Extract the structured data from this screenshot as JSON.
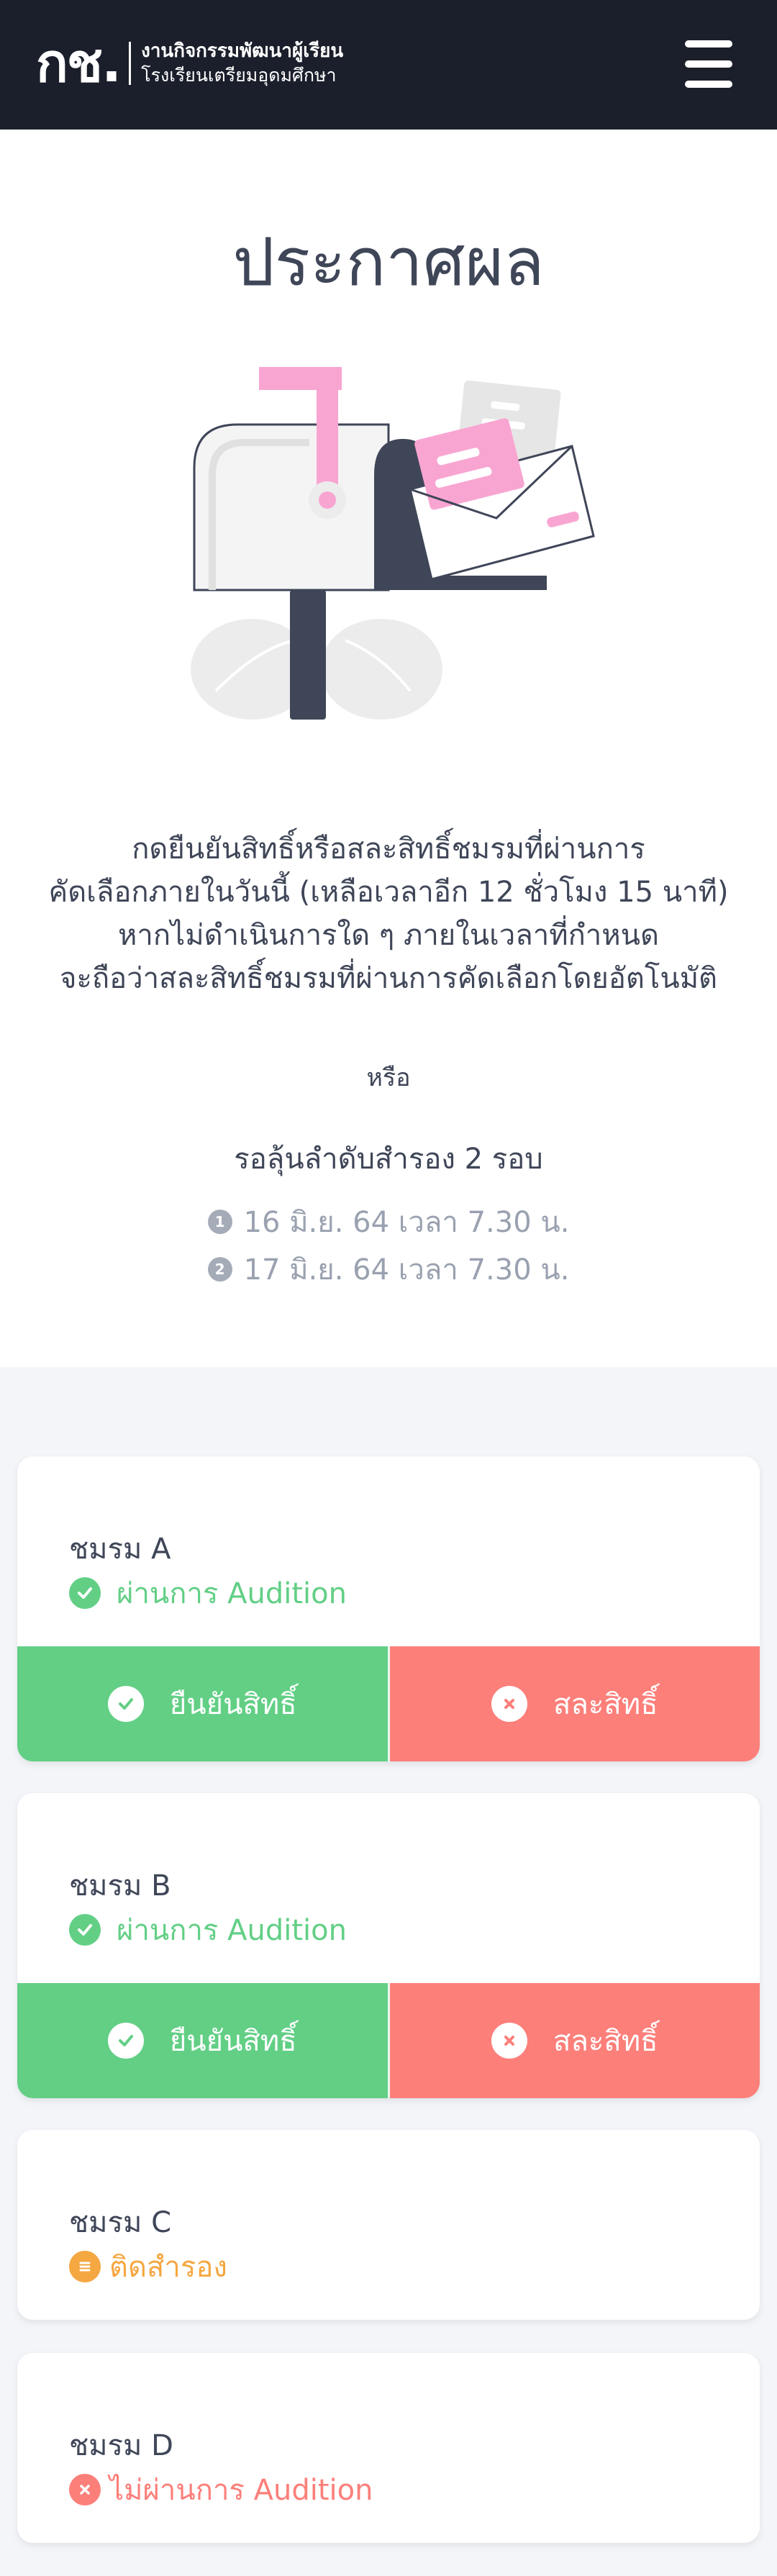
{
  "header": {
    "logo_mark": "กช.",
    "logo_line1": "งานกิจกรรมพัฒนาผู้เรียน",
    "logo_line2": "โรงเรียนเตรียมอุดมศึกษา"
  },
  "page": {
    "title": "ประกาศผล",
    "instructions": [
      "กดยืนยันสิทธิ์หรือสละสิทธิ์ชมรมที่ผ่านการ",
      "คัดเลือกภายในวันนี้ (เหลือเวลาอีก 12 ชั่วโมง 15 นาที)",
      "หากไม่ดำเนินการใด ๆ ภายในเวลาที่กำหนด",
      "จะถือว่าสละสิทธิ์ชมรมที่ผ่านการคัดเลือกโดยอัตโนมัติ"
    ],
    "or": "หรือ",
    "waitlist_heading": "รอลุ้นลำดับสำรอง 2 รอบ",
    "rounds": [
      {
        "num": "1",
        "text": "16 มิ.ย. 64 เวลา 7.30 น."
      },
      {
        "num": "2",
        "text": "17 มิ.ย. 64 เวลา 7.30 น."
      }
    ]
  },
  "cards": [
    {
      "name": "ชมรม A",
      "status": "ผ่านการ Audition",
      "status_type": "passed",
      "confirm": "ยืนยันสิทธิ์",
      "waive": "สละสิทธิ์"
    },
    {
      "name": "ชมรม B",
      "status": "ผ่านการ Audition",
      "status_type": "passed",
      "confirm": "ยืนยันสิทธิ์",
      "waive": "สละสิทธิ์"
    },
    {
      "name": "ชมรม C",
      "status": "ติดสำรอง",
      "status_type": "reserve"
    },
    {
      "name": "ชมรม D",
      "status": "ไม่ผ่านการ Audition",
      "status_type": "failed"
    }
  ],
  "colors": {
    "header_bg": "#1b1f2b",
    "passed": "#62cf85",
    "reserve": "#f5a742",
    "failed": "#fc7f7a",
    "text": "#3f4658",
    "muted": "#9aa1b0",
    "pink": "#f9a5d2"
  },
  "icons": {
    "menu": "hamburger-menu-icon",
    "passed": "check-circle-icon",
    "reserve": "list-circle-icon",
    "failed": "x-circle-icon"
  }
}
